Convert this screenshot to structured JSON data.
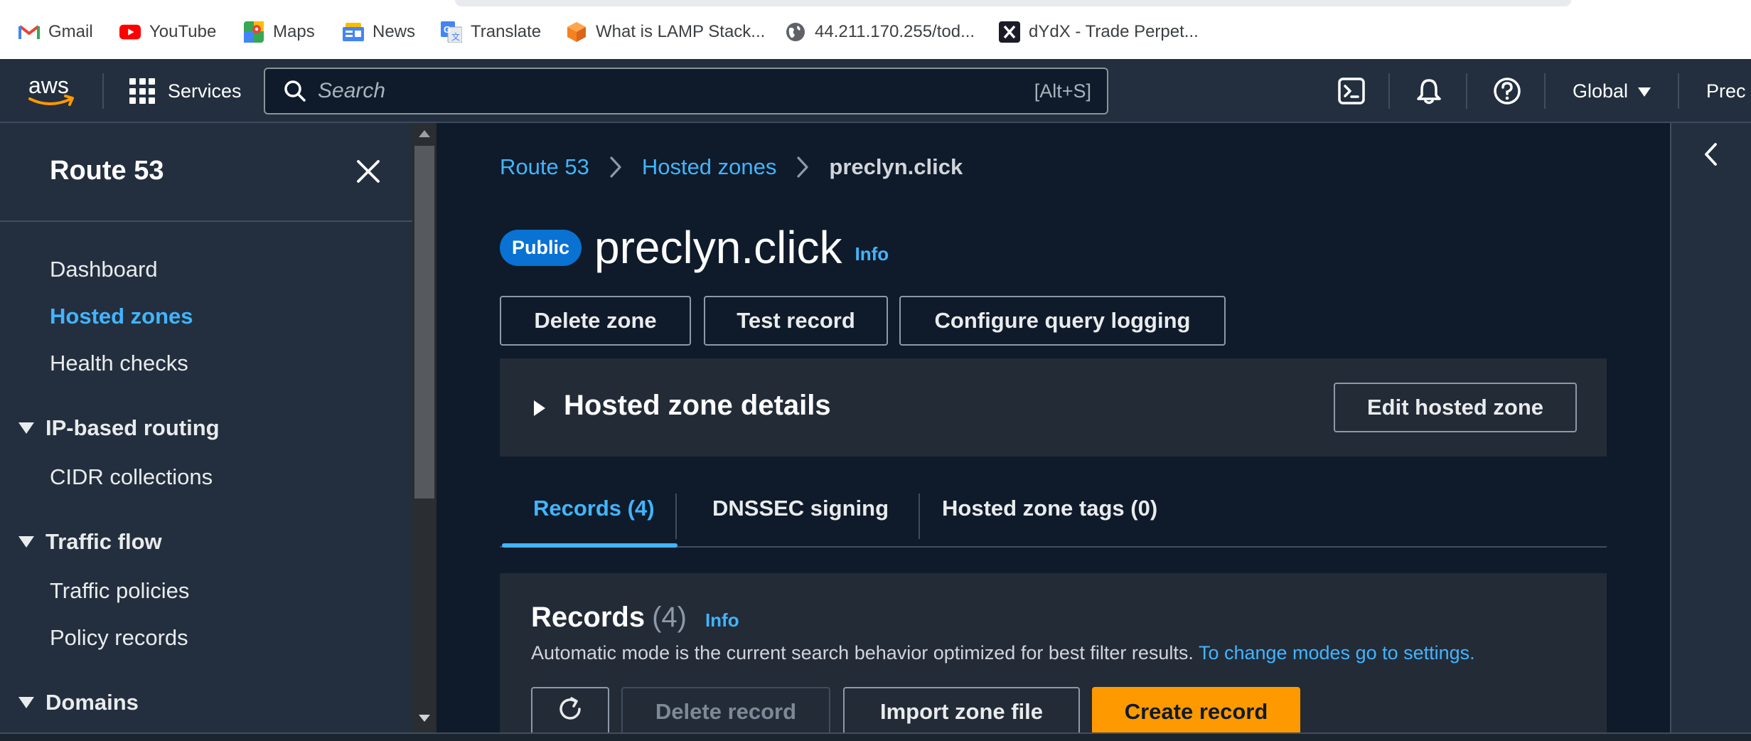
{
  "bookmarks": [
    {
      "label": "Gmail",
      "icon": "gmail-icon"
    },
    {
      "label": "YouTube",
      "icon": "youtube-icon"
    },
    {
      "label": "Maps",
      "icon": "maps-icon"
    },
    {
      "label": "News",
      "icon": "news-icon"
    },
    {
      "label": "Translate",
      "icon": "translate-icon"
    },
    {
      "label": "What is LAMP Stack...",
      "icon": "cube-icon"
    },
    {
      "label": "44.211.170.255/tod...",
      "icon": "globe-icon"
    },
    {
      "label": "dYdX - Trade Perpet...",
      "icon": "dydx-icon"
    }
  ],
  "topnav": {
    "logo": "aws",
    "services_label": "Services",
    "search_placeholder": "Search",
    "search_shortcut": "[Alt+S]",
    "region_label": "Global",
    "account_label": "Prec"
  },
  "sidebar": {
    "title": "Route 53",
    "items": [
      {
        "label": "Dashboard",
        "active": false
      },
      {
        "label": "Hosted zones",
        "active": true
      },
      {
        "label": "Health checks",
        "active": false
      }
    ],
    "sections": [
      {
        "label": "IP-based routing",
        "items": [
          "CIDR collections"
        ]
      },
      {
        "label": "Traffic flow",
        "items": [
          "Traffic policies",
          "Policy records"
        ]
      },
      {
        "label": "Domains",
        "items": []
      }
    ]
  },
  "breadcrumb": [
    "Route 53",
    "Hosted zones",
    "preclyn.click"
  ],
  "zone": {
    "badge": "Public",
    "name": "preclyn.click",
    "info": "Info"
  },
  "actions": {
    "delete_zone": "Delete zone",
    "test_record": "Test record",
    "configure_logging": "Configure query logging"
  },
  "details": {
    "label": "Hosted zone details",
    "edit_button": "Edit hosted zone"
  },
  "tabs": [
    {
      "label": "Records (4)",
      "active": true
    },
    {
      "label": "DNSSEC signing",
      "active": false
    },
    {
      "label": "Hosted zone tags (0)",
      "active": false
    }
  ],
  "records": {
    "title": "Records",
    "count": "(4)",
    "info": "Info",
    "description": "Automatic mode is the current search behavior optimized for best filter results.",
    "settings_link": "To change modes go to settings.",
    "delete_button": "Delete record",
    "import_button": "Import zone file",
    "create_button": "Create record"
  },
  "colors": {
    "accent": "#42b4ff",
    "primary_button": "#ff9900",
    "badge": "#0972d3",
    "nav_bg": "#232f3e",
    "page_bg": "#0f1b2a"
  }
}
